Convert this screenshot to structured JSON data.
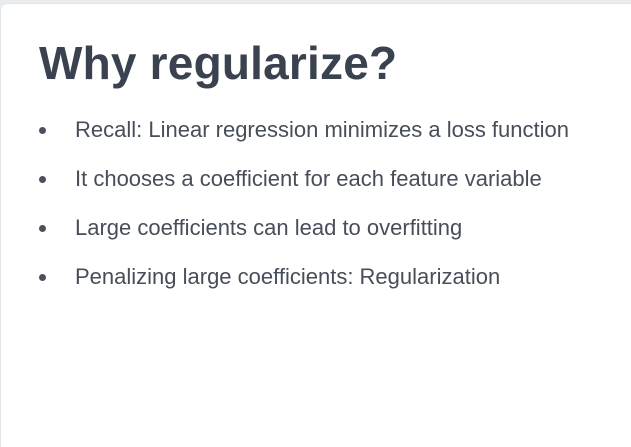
{
  "slide": {
    "title": "Why regularize?",
    "bullets": [
      "Recall: Linear regression minimizes a loss function",
      "It chooses a coefficient for each feature variable",
      "Large coefficients can lead to overfitting",
      "Penalizing large coefficients: Regularization"
    ]
  }
}
